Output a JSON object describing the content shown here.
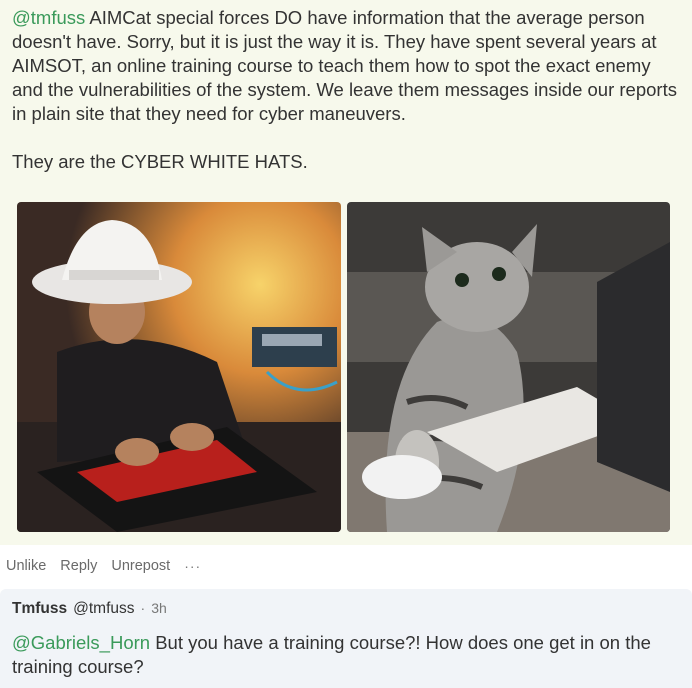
{
  "post": {
    "mention": "@tmfuss",
    "body": " AIMCat special forces DO have information that the average person doesn't have. Sorry, but it is just the way it is. They have spent several years at AIMSOT, an online training course to teach them how to spot the exact enemy and the vulnerabilities of the system. We leave them messages inside our reports in plain site that they need for cyber maneuvers.",
    "closing": "They are the CYBER WHITE HATS.",
    "images": [
      {
        "icon": "photo-hacker-white-fedora"
      },
      {
        "icon": "photo-tabby-cat-keyboard"
      }
    ]
  },
  "actions": {
    "unlike": "Unlike",
    "reply": "Reply",
    "unrepost": "Unrepost",
    "more": "···"
  },
  "reply": {
    "name": "Tmfuss",
    "handle": "@tmfuss",
    "separator": "·",
    "time": "3h",
    "mention": "@Gabriels_Horn",
    "body": " But you have a training course?! How does one get in on the training course?"
  },
  "colors": {
    "post_bg": "#f7f9ec",
    "reply_bg": "#f1f4f8",
    "mention": "#3a9a5a"
  }
}
